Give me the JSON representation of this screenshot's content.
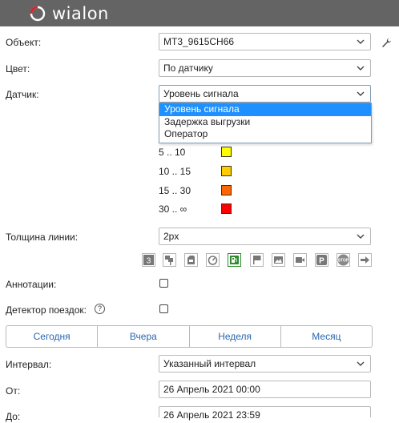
{
  "app": {
    "logo_text": "wialon"
  },
  "fields": {
    "object": {
      "label": "Объект:",
      "value": "MT3_9615CH66"
    },
    "color": {
      "label": "Цвет:",
      "value": "По датчику"
    },
    "sensor": {
      "label": "Датчик:",
      "value": "Уровень сигнала",
      "options": [
        "Уровень сигнала",
        "Задержка выгрузки",
        "Оператор"
      ]
    },
    "line_width": {
      "label": "Толщина линии:",
      "value": "2px"
    },
    "annotations": {
      "label": "Аннотации:"
    },
    "trip_detector": {
      "label": "Детектор поездок:",
      "help": "?"
    },
    "interval": {
      "label": "Интервал:",
      "value": "Указанный интервал"
    },
    "from": {
      "label": "От:",
      "value": "26 Апрель 2021 00:00"
    },
    "to": {
      "label": "До:",
      "value": "26 Апрель 2021 23:59"
    }
  },
  "ranges": [
    {
      "label": "5 .. 10",
      "color": "#ffff00"
    },
    {
      "label": "10 .. 15",
      "color": "#ffcc00"
    },
    {
      "label": "15 .. 30",
      "color": "#ff6600"
    },
    {
      "label": "30 .. ∞",
      "color": "#ff0000"
    }
  ],
  "marker_icons": [
    {
      "name": "three-icon",
      "glyph": "3"
    },
    {
      "name": "flags-icon"
    },
    {
      "name": "fuel-can-icon"
    },
    {
      "name": "gauge-icon"
    },
    {
      "name": "fuel-pump-icon",
      "active": true
    },
    {
      "name": "flag-icon"
    },
    {
      "name": "image-icon"
    },
    {
      "name": "video-icon"
    },
    {
      "name": "parking-icon",
      "glyph": "P"
    },
    {
      "name": "stop-icon",
      "glyph": "STOP"
    },
    {
      "name": "arrow-right-icon"
    }
  ],
  "period_tabs": [
    "Сегодня",
    "Вчера",
    "Неделя",
    "Месяц"
  ],
  "colors": {
    "header_bg": "#646464",
    "accent": "#1e90ff",
    "link": "#2a67b0",
    "logo_red": "#e21c2c"
  }
}
